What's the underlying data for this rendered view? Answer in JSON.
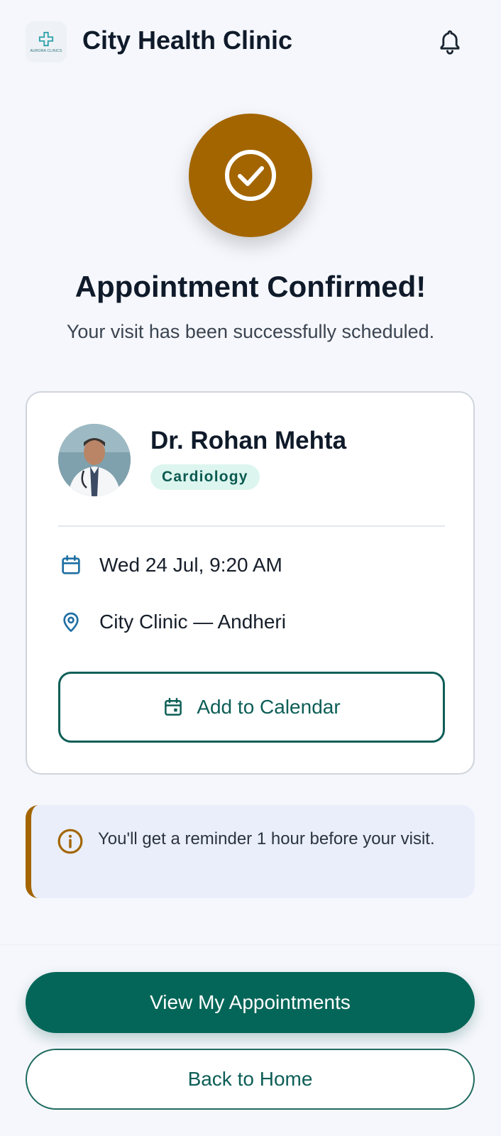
{
  "header": {
    "title": "City Health Clinic",
    "logo_text": "AURORA CLINICS",
    "notification_icon": "bell-icon"
  },
  "confirmation": {
    "icon": "check-circle-icon",
    "title": "Appointment Confirmed!",
    "subtitle": "Your visit has been successfully scheduled."
  },
  "appointment": {
    "doctor_name": "Dr. Rohan Mehta",
    "specialty": "Cardiology",
    "datetime": "Wed 24 Jul, 9:20 AM",
    "location": "City Clinic — Andheri",
    "calendar_button_label": "Add to Calendar"
  },
  "reminder": {
    "text": "You'll get a reminder 1 hour before your visit."
  },
  "actions": {
    "primary_label": "View My Appointments",
    "secondary_label": "Back to Home"
  },
  "colors": {
    "brand_green": "#046658",
    "accent_amber": "#a36500",
    "specialty_bg": "#ddf5ef",
    "reminder_bg": "#e9eefa"
  }
}
